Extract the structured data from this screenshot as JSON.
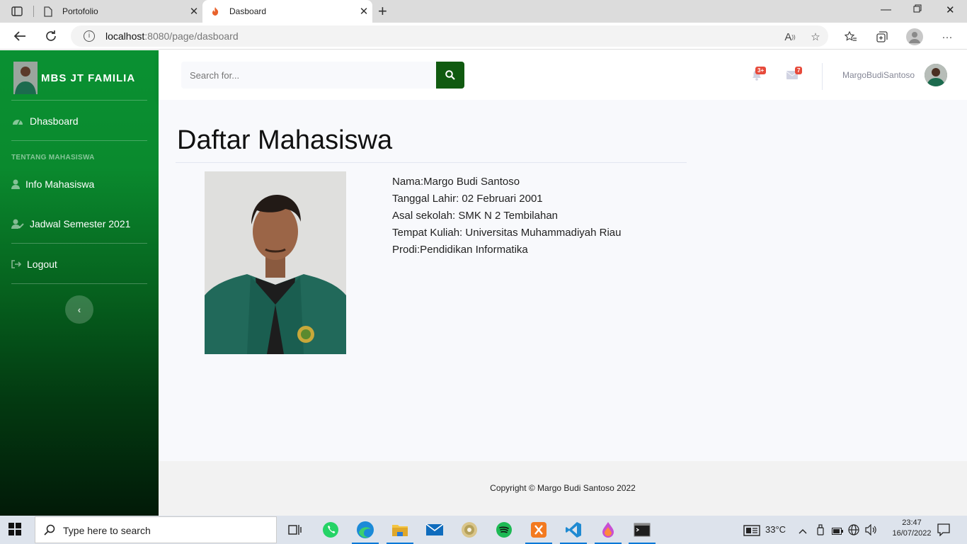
{
  "browser": {
    "tabs": [
      {
        "title": "Portofolio",
        "active": false
      },
      {
        "title": "Dasboard",
        "active": true
      }
    ],
    "url_host": "localhost",
    "url_rest": ":8080/page/dasboard"
  },
  "sidebar": {
    "brand": "MBS JT FAMILIA",
    "dashboard_label": "Dhasboard",
    "section_heading": "TENTANG MAHASISWA",
    "items": [
      {
        "label": "Info Mahasiswa",
        "icon": "user-icon"
      },
      {
        "label": "Jadwal Semester 2021",
        "icon": "user-edit-icon"
      },
      {
        "label": "Logout",
        "icon": "sign-out-icon"
      }
    ],
    "toggle_icon": "chevron-left-icon"
  },
  "topbar": {
    "search_placeholder": "Search for...",
    "alerts_badge": "3+",
    "messages_badge": "7",
    "user_name": "MargoBudiSantoso"
  },
  "main": {
    "page_title": "Daftar Mahasiswa",
    "info_lines": [
      "Nama:Margo Budi Santoso",
      "Tanggal Lahir: 02 Februari 2001",
      "Asal sekolah: SMK N 2 Tembilahan",
      "Tempat Kuliah: Universitas Muhammadiyah Riau",
      "Prodi:Pendidikan Informatika"
    ]
  },
  "footer": {
    "copyright": "Copyright © Margo Budi Santoso 2022"
  },
  "taskbar": {
    "search_placeholder": "Type here to search",
    "temperature": "33°C",
    "time": "23:47",
    "date": "16/07/2022"
  },
  "colors": {
    "sidebar_top": "#0a9132",
    "sidebar_bottom": "#021a08",
    "search_button": "#105a10",
    "badge": "#e74a3b"
  }
}
